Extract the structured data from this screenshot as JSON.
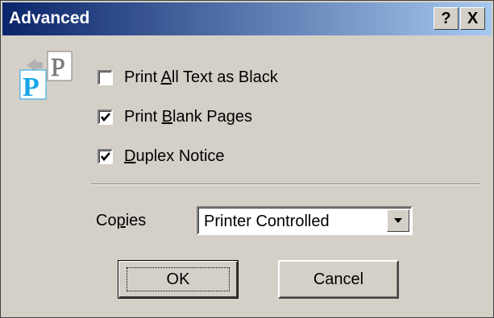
{
  "window": {
    "title": "Advanced",
    "help_label": "?",
    "close_label": "X"
  },
  "options": [
    {
      "prefix": "Print ",
      "accel": "A",
      "suffix": "ll Text as Black",
      "checked": false
    },
    {
      "prefix": "Print ",
      "accel": "B",
      "suffix": "lank Pages",
      "checked": true
    },
    {
      "prefix": "",
      "accel": "D",
      "suffix": "uplex Notice",
      "checked": true
    }
  ],
  "copies": {
    "label_accel": "C",
    "label_rest_1": "o",
    "label_accel_2": "p",
    "label_rest_2": "ies",
    "value": "Printer Controlled"
  },
  "buttons": {
    "ok": "OK",
    "cancel": "Cancel"
  },
  "colors": {
    "title_start": "#0a246a",
    "title_end": "#a6caf0",
    "face": "#d4d0c8",
    "icon_blue": "#1aa6e8"
  },
  "icons": [
    "printer-pages-icon",
    "help-icon",
    "close-icon",
    "dropdown-arrow-icon",
    "checkmark-icon"
  ]
}
